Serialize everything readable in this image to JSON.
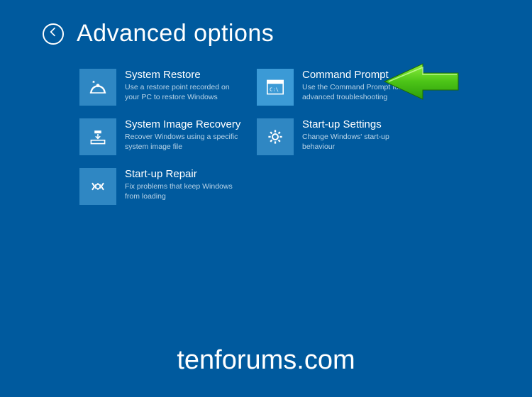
{
  "header": {
    "title": "Advanced options"
  },
  "tiles": [
    {
      "id": "system-restore",
      "title": "System Restore",
      "desc": "Use a restore point recorded on your PC to restore Windows",
      "icon": "restore-icon"
    },
    {
      "id": "command-prompt",
      "title": "Command Prompt",
      "desc": "Use the Command Prompt for advanced troubleshooting",
      "icon": "cmd-icon",
      "highlight": true
    },
    {
      "id": "system-image-recovery",
      "title": "System Image Recovery",
      "desc": "Recover Windows using a specific system image file",
      "icon": "image-recovery-icon"
    },
    {
      "id": "startup-settings",
      "title": "Start-up Settings",
      "desc": "Change Windows' start-up behaviour",
      "icon": "gear-icon"
    },
    {
      "id": "startup-repair",
      "title": "Start-up Repair",
      "desc": "Fix problems that keep Windows from loading",
      "icon": "repair-icon"
    }
  ],
  "watermark": "tenforums.com"
}
